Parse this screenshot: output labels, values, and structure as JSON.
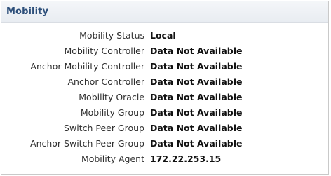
{
  "panel": {
    "title": "Mobility",
    "rows": [
      {
        "label": "Mobility Status",
        "value": "Local"
      },
      {
        "label": "Mobility Controller",
        "value": "Data Not Available"
      },
      {
        "label": "Anchor Mobility Controller",
        "value": "Data Not Available"
      },
      {
        "label": "Anchor Controller",
        "value": "Data Not Available"
      },
      {
        "label": "Mobility Oracle",
        "value": "Data Not Available"
      },
      {
        "label": "Mobility Group",
        "value": "Data Not Available"
      },
      {
        "label": "Switch Peer Group",
        "value": "Data Not Available"
      },
      {
        "label": "Anchor Switch Peer Group",
        "value": "Data Not Available"
      },
      {
        "label": "Mobility Agent",
        "value": "172.22.253.15"
      }
    ]
  },
  "colors": {
    "title": "#2d4f7a",
    "header_bg": "#e8ecf1",
    "border": "#c9c9c9"
  }
}
